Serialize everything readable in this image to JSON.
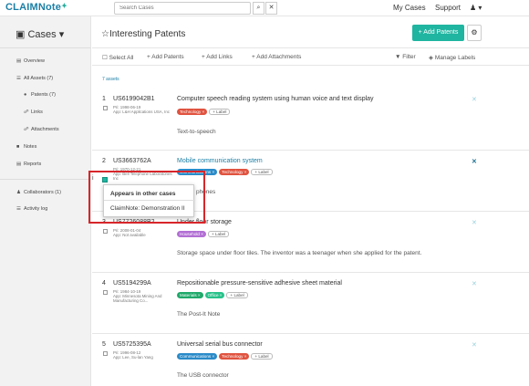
{
  "header": {
    "logo": "CLAIMNote",
    "search_placeholder": "Search Cases",
    "search_btn": "🔍",
    "clear_btn": "✕",
    "my_cases": "My Cases",
    "support": "Support",
    "user_icon": "👤 ▾"
  },
  "sidebar": {
    "title": "Cases ▾",
    "items": {
      "overview": "Overview",
      "all_assets": "All Assets (7)",
      "patents": "Patents (7)",
      "links": "Links",
      "attachments": "Attachments",
      "notes": "Notes",
      "reports": "Reports",
      "collaborators": "Collaborators (1)",
      "activity_log": "Activity log"
    }
  },
  "page": {
    "title": "Interesting Patents",
    "add_patents": "+ Add Patents",
    "count": "7 assets"
  },
  "toolbar": {
    "select_all": "Select All",
    "add_patents": "Add Patents",
    "add_links": "Add Links",
    "add_attachments": "Add Attachments",
    "filter": "Filter",
    "manage_labels": "Manage Labels"
  },
  "rows": [
    {
      "num": "1",
      "id": "US6199042B1",
      "meta1": "Pri: 1998-06-19",
      "meta2": "App: L&H Applications USA, Inc",
      "title": "Computer speech reading system using human voice and text display",
      "tags": [
        "Technology ×"
      ],
      "label": "+ Label",
      "desc": "Text-to-speech"
    },
    {
      "num": "2",
      "id": "US3663762A",
      "meta1": "Pri: 1970-12-21",
      "meta2": "App: Bell Telephone Laboratories Inc",
      "title": "Mobile communication system",
      "tags": [
        "Communications ×",
        "Technology ×"
      ],
      "label": "+ Label",
      "desc": "Mobile phones"
    },
    {
      "num": "3",
      "id": "US7726088B2",
      "meta1": "Pri: 2008-01-04",
      "meta2": "App: Not available",
      "title": "Under floor storage",
      "tags": [
        "Household ×"
      ],
      "label": "+ Label",
      "desc": "Storage space under floor tiles. The inventor was a teenager when she applied for the patent."
    },
    {
      "num": "4",
      "id": "US5194299A",
      "meta1": "Pri: 1984-10-19",
      "meta2": "App: Minnesota Mining And Manufacturing Co...",
      "title": "Repositionable pressure-sensitive adhesive sheet material",
      "tags": [
        "Materials ×",
        "Office ×"
      ],
      "label": "+ Label",
      "desc": "The Post-It Note"
    },
    {
      "num": "5",
      "id": "US5725395A",
      "meta1": "Pri: 1996-08-12",
      "meta2": "App: Lee, Su-lan Yang",
      "title": "Universal serial bus connector",
      "tags": [
        "Communications ×",
        "Technology ×"
      ],
      "label": "+ Label",
      "desc": "The USB connector"
    }
  ],
  "popover": {
    "heading": "Appears in other cases",
    "item": "ClaimNote: Demonstration II"
  },
  "colors": {
    "technology": "#e0533f",
    "communications": "#2a8bc9",
    "household": "#b26fd4",
    "materials": "#1fa96a",
    "office": "#27c28a",
    "accent": "#1fb5a0",
    "highlight_box": "#d7262a"
  }
}
